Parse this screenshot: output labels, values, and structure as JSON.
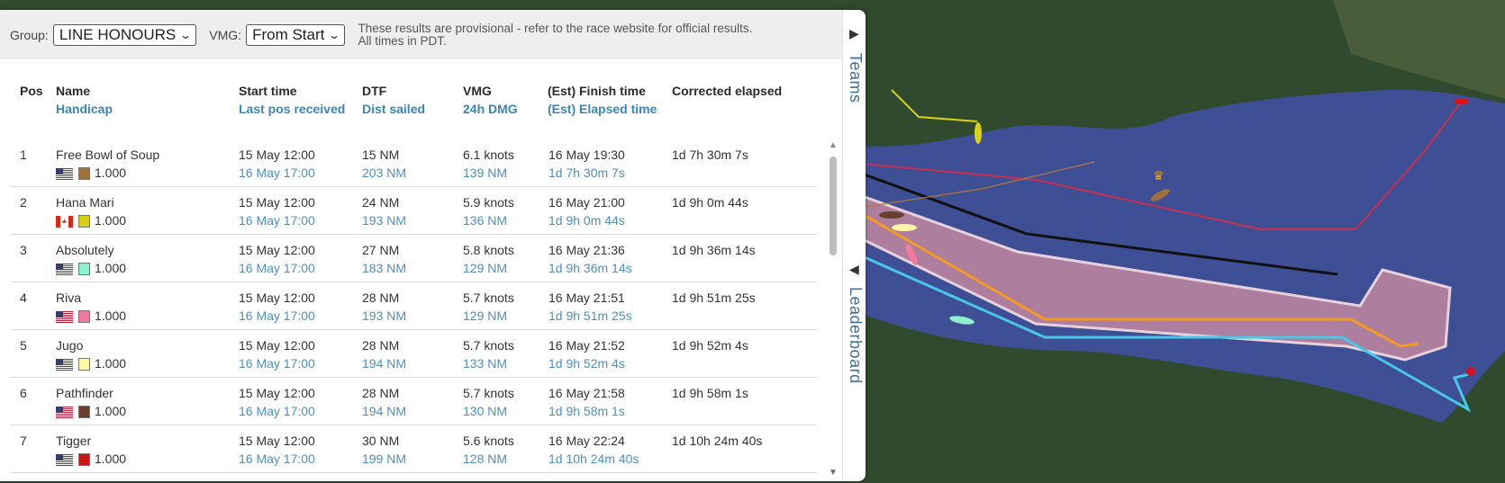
{
  "filters": {
    "group_label": "Group:",
    "group_value": "LINE HONOURS",
    "vmg_label": "VMG:",
    "vmg_value": "From Start",
    "notice_line1": "These results are provisional - refer to the race website for official results.",
    "notice_line2": "All times in PDT."
  },
  "side_tabs": {
    "teams": "Teams",
    "leaderboard": "Leaderboard"
  },
  "columns": {
    "pos": "Pos",
    "name": "Name",
    "handicap": "Handicap",
    "start": "Start time",
    "last_pos": "Last pos received",
    "dtf": "DTF",
    "dist_sailed": "Dist sailed",
    "vmg": "VMG",
    "dmg": "24h DMG",
    "finish": "(Est) Finish time",
    "elapsed": "(Est) Elapsed time",
    "corrected": "Corrected elapsed"
  },
  "rows": [
    {
      "pos": "1",
      "name": "Free Bowl of Soup",
      "flag": "us",
      "color": "#a0703a",
      "handicap": "1.000",
      "start": "15 May 12:00",
      "last": "16 May 17:00",
      "dtf": "15 NM",
      "sailed": "203 NM",
      "vmg": "6.1 knots",
      "dmg": "139 NM",
      "finish": "16 May 19:30",
      "elapsed": "1d 7h 30m 7s",
      "corrected": "1d 7h 30m 7s"
    },
    {
      "pos": "2",
      "name": "Hana Mari",
      "flag": "ca",
      "color": "#d6cc1a",
      "handicap": "1.000",
      "start": "15 May 12:00",
      "last": "16 May 17:00",
      "dtf": "24 NM",
      "sailed": "193 NM",
      "vmg": "5.9 knots",
      "dmg": "136 NM",
      "finish": "16 May 21:00",
      "elapsed": "1d 9h 0m 44s",
      "corrected": "1d 9h 0m 44s"
    },
    {
      "pos": "3",
      "name": "Absolutely",
      "flag": "us",
      "color": "#8ff0d0",
      "handicap": "1.000",
      "start": "15 May 12:00",
      "last": "16 May 17:00",
      "dtf": "27 NM",
      "sailed": "183 NM",
      "vmg": "5.8 knots",
      "dmg": "129 NM",
      "finish": "16 May 21:36",
      "elapsed": "1d 9h 36m 14s",
      "corrected": "1d 9h 36m 14s"
    },
    {
      "pos": "4",
      "name": "Riva",
      "flag": "us",
      "color": "#f07aa0",
      "handicap": "1.000",
      "start": "15 May 12:00",
      "last": "16 May 17:00",
      "dtf": "28 NM",
      "sailed": "193 NM",
      "vmg": "5.7 knots",
      "dmg": "129 NM",
      "finish": "16 May 21:51",
      "elapsed": "1d 9h 51m 25s",
      "corrected": "1d 9h 51m 25s"
    },
    {
      "pos": "5",
      "name": "Jugo",
      "flag": "us",
      "color": "#fff6a8",
      "handicap": "1.000",
      "start": "15 May 12:00",
      "last": "16 May 17:00",
      "dtf": "28 NM",
      "sailed": "194 NM",
      "vmg": "5.7 knots",
      "dmg": "133 NM",
      "finish": "16 May 21:52",
      "elapsed": "1d 9h 52m 4s",
      "corrected": "1d 9h 52m 4s"
    },
    {
      "pos": "6",
      "name": "Pathfinder",
      "flag": "us",
      "color": "#6b3f2e",
      "handicap": "1.000",
      "start": "15 May 12:00",
      "last": "16 May 17:00",
      "dtf": "28 NM",
      "sailed": "194 NM",
      "vmg": "5.7 knots",
      "dmg": "130 NM",
      "finish": "16 May 21:58",
      "elapsed": "1d 9h 58m 1s",
      "corrected": "1d 9h 58m 1s"
    },
    {
      "pos": "7",
      "name": "Tigger",
      "flag": "us",
      "color": "#c81818",
      "handicap": "1.000",
      "start": "15 May 12:00",
      "last": "16 May 17:00",
      "dtf": "30 NM",
      "sailed": "199 NM",
      "vmg": "5.6 knots",
      "dmg": "128 NM",
      "finish": "16 May 22:24",
      "elapsed": "1d 10h 24m 40s",
      "corrected": "1d 10h 24m 40s"
    }
  ],
  "map": {
    "water": "#3e4f96",
    "land": "#2f4a2c",
    "course_fill": "#c98aa0"
  }
}
